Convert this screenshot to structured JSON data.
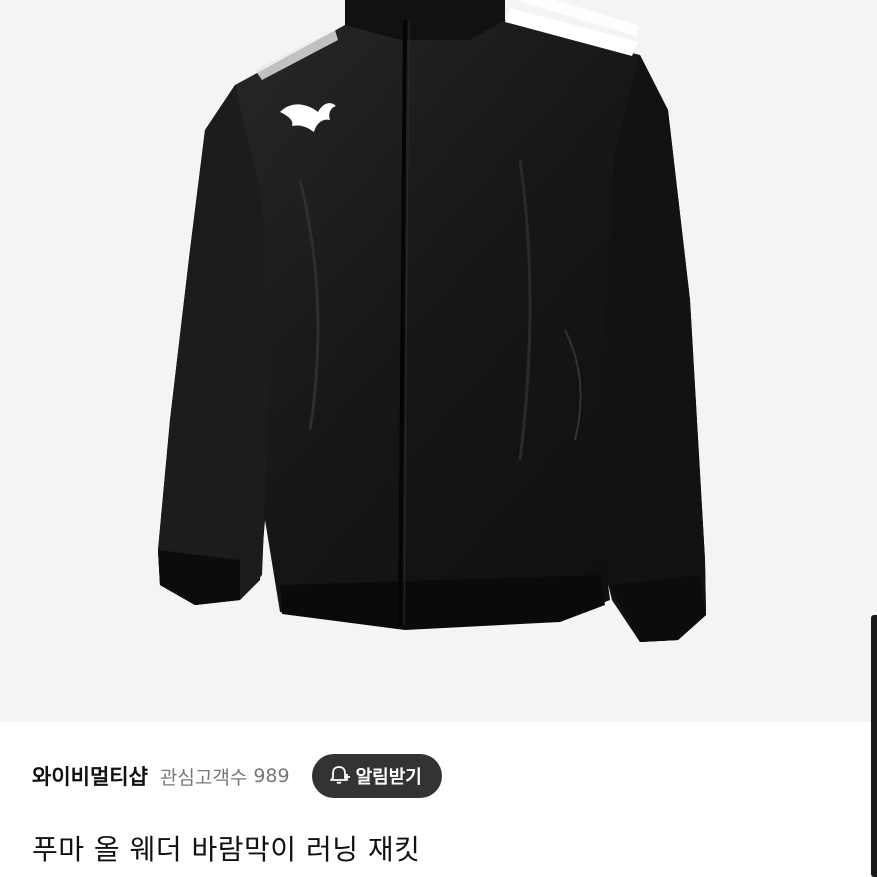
{
  "product": {
    "image": {
      "icon": "jacket-photo",
      "logo": "puma-logo-icon"
    },
    "title": "푸마 올 웨더 바람막이 러닝 재킷"
  },
  "shop": {
    "name": "와이비멀티샵",
    "follower_label": "관심고객수",
    "follower_count": "989",
    "alert_button_label": "알림받기",
    "alert_icon": "bell-plus-icon"
  },
  "colors": {
    "hero_bg": "#f4f4f4",
    "jacket": "#1a1a1a",
    "button_bg": "#333333"
  }
}
